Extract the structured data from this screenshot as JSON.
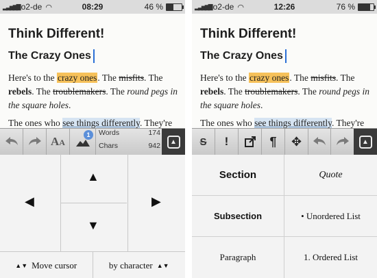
{
  "status_left": {
    "carrier": "o2-de",
    "time": "08:29",
    "battery_text": "46 %",
    "battery_level": 0.46
  },
  "status_right": {
    "carrier": "o2-de",
    "time": "12:26",
    "battery_text": "76 %",
    "battery_level": 0.76
  },
  "document": {
    "title": "Think Different!",
    "subtitle": "The Crazy Ones",
    "p1": [
      "Here's to the ",
      "crazy ones",
      ". The ",
      "misfits",
      ". The ",
      "rebels",
      ". The ",
      "troublemakers",
      ". The ",
      "round pegs in the square holes",
      "."
    ],
    "p2": [
      "The ones who ",
      "see things differently",
      ". They're"
    ]
  },
  "left_toolbar": {
    "words_label": "Words",
    "words_value": "174",
    "chars_label": "Chars",
    "chars_value": "942",
    "badge": "1",
    "icons": [
      "undo-icon",
      "redo-icon",
      "text-size-icon",
      "image-icon",
      "keyboard-toggle-icon"
    ]
  },
  "cursor_pad": {
    "move_label": "Move cursor",
    "mode_label": "by character"
  },
  "right_toolbar": {
    "icons": [
      "strikethrough-icon",
      "exclamation-icon",
      "link-icon",
      "pilcrow-icon",
      "move-icon",
      "undo-icon",
      "redo-icon",
      "keyboard-toggle-icon"
    ]
  },
  "formats": {
    "section": "Section",
    "quote": "Quote",
    "subsection": "Subsection",
    "unordered": "• Unordered List",
    "paragraph": "Paragraph",
    "ordered": "1. Ordered List"
  }
}
